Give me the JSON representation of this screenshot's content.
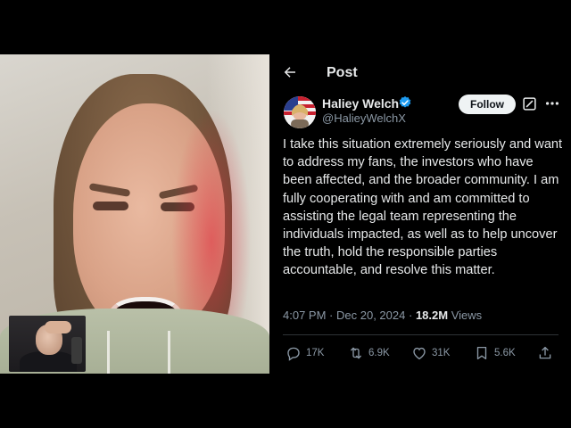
{
  "header": {
    "title": "Post"
  },
  "author": {
    "display_name": "Haliey Welch",
    "handle": "@HalieyWelchX",
    "follow_label": "Follow"
  },
  "post": {
    "body": "I take this situation extremely seriously and want to address my fans, the investors who have been affected, and the broader community. I am fully cooperating with and am committed to assisting the legal team representing the individuals impacted, as well as to help uncover the truth, hold the responsible parties accountable, and resolve this matter.",
    "time": "4:07 PM",
    "separator": "·",
    "date": "Dec 20, 2024",
    "views_count": "18.2M",
    "views_label": "Views"
  },
  "actions": {
    "replies": "17K",
    "reposts": "6.9K",
    "likes": "31K",
    "bookmarks": "5.6K"
  },
  "icons": [
    "back-arrow-icon",
    "verified-badge-icon",
    "grok-icon",
    "more-icon",
    "reply-icon",
    "repost-icon",
    "like-icon",
    "bookmark-icon",
    "share-icon"
  ],
  "colors": {
    "verified": "#1d9bf0",
    "background": "#000000",
    "text": "#e7e9ea",
    "muted": "#8b98a5"
  }
}
